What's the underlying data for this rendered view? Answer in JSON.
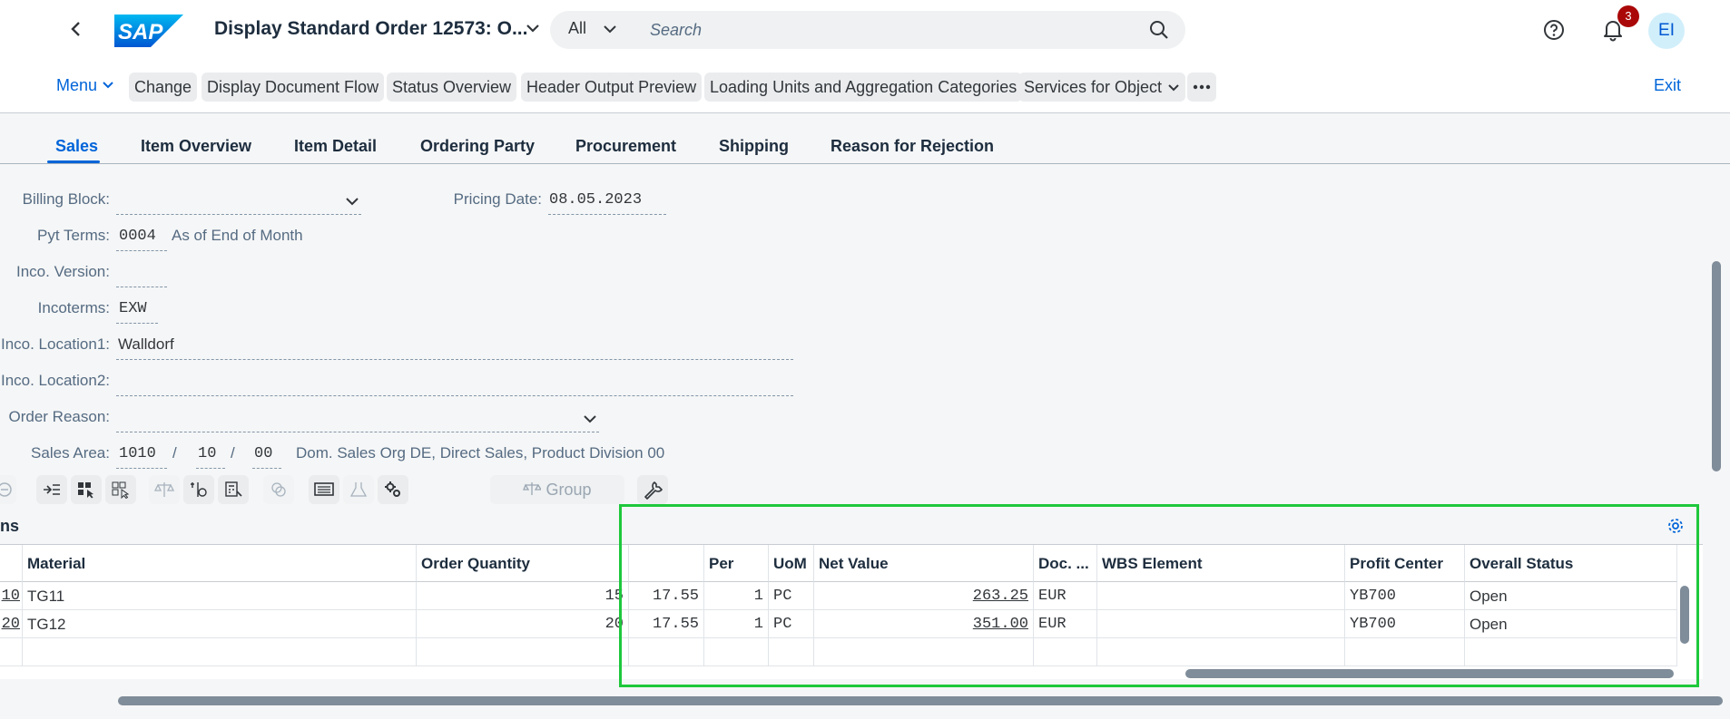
{
  "shell": {
    "title": "Display Standard Order 12573: O...",
    "logo_text": "SAP",
    "search_scope": "All",
    "search_placeholder": "Search",
    "notification_count": "3",
    "avatar_initials": "EI"
  },
  "toolbar": {
    "menu": "Menu",
    "buttons": [
      "Change",
      "Display Document Flow",
      "Status Overview",
      "Header Output Preview",
      "Loading Units and Aggregation Categories",
      "Services for Object"
    ],
    "exit": "Exit"
  },
  "tabs": [
    "Sales",
    "Item Overview",
    "Item Detail",
    "Ordering Party",
    "Procurement",
    "Shipping",
    "Reason for Rejection"
  ],
  "form": {
    "billing_block": {
      "label": "Billing Block:",
      "value": ""
    },
    "pricing_date": {
      "label": "Pricing Date:",
      "value": "08.05.2023"
    },
    "pyt_terms": {
      "label": "Pyt Terms:",
      "value": "0004",
      "description": "As of End of Month"
    },
    "inco_version": {
      "label": "Inco. Version:",
      "value": ""
    },
    "incoterms": {
      "label": "Incoterms:",
      "value": "EXW"
    },
    "inco_location1": {
      "label": "Inco. Location1:",
      "value": "Walldorf"
    },
    "inco_location2": {
      "label": "Inco. Location2:",
      "value": ""
    },
    "order_reason": {
      "label": "Order Reason:",
      "value": ""
    },
    "sales_area": {
      "label": "Sales Area:",
      "org": "1010",
      "sep1": "/",
      "channel": "10",
      "sep2": "/",
      "division": "00",
      "description": "Dom. Sales Org DE, Direct Sales, Product Division 00"
    }
  },
  "item_toolbar": {
    "group": "Group"
  },
  "items": {
    "title": "ns",
    "columns": [
      "",
      "Material",
      "Order Quantity",
      "",
      "Per",
      "UoM",
      "Net Value",
      "Doc. ...",
      "WBS Element",
      "Profit Center",
      "Overall Status"
    ],
    "rows": [
      {
        "item": "10",
        "material": "TG11",
        "qty": "15",
        "price": "17.55",
        "per": "1",
        "uom": "PC",
        "net": "263.25",
        "curr": "EUR",
        "wbs": "",
        "pc": "YB700",
        "status": "Open"
      },
      {
        "item": "20",
        "material": "TG12",
        "qty": "20",
        "price": "17.55",
        "per": "1",
        "uom": "PC",
        "net": "351.00",
        "curr": "EUR",
        "wbs": "",
        "pc": "YB700",
        "status": "Open"
      }
    ]
  },
  "colors": {
    "accent": "#0064d9",
    "highlight": "#1ec83c",
    "badge": "#aa0808"
  }
}
